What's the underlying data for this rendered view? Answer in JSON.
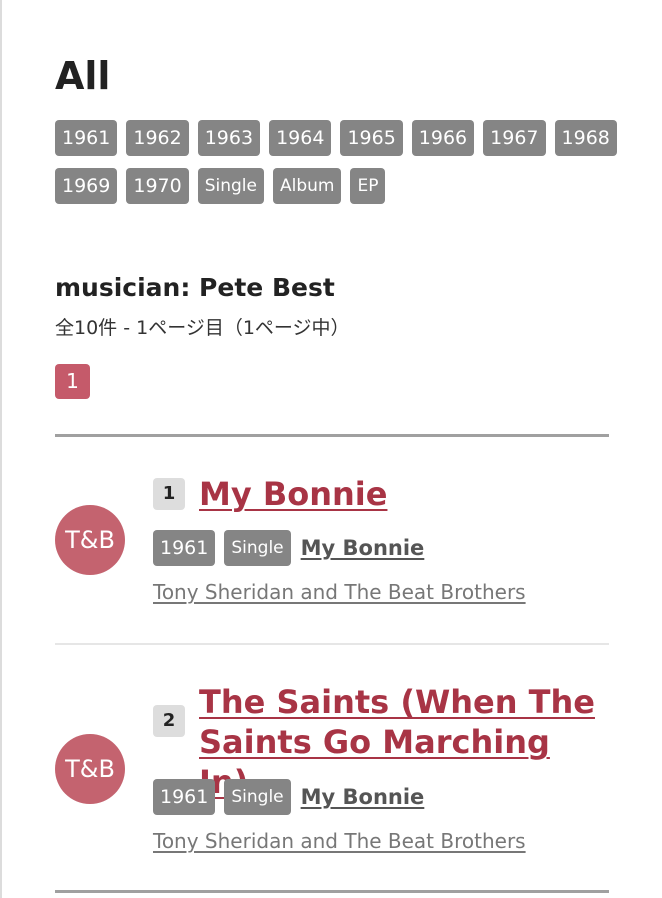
{
  "page": {
    "title": "All"
  },
  "filters": {
    "row1": [
      "1961",
      "1962",
      "1963",
      "1964",
      "1965",
      "1966",
      "1967",
      "1968"
    ],
    "row2": [
      "1969",
      "1970",
      "Single",
      "Album",
      "EP"
    ]
  },
  "section": {
    "heading": "musician: Pete Best",
    "summary": "全10件 - 1ページ目（1ページ中）"
  },
  "pagination": {
    "current": "1"
  },
  "tracks": [
    {
      "number": "1",
      "title": "My Bonnie",
      "avatar": "T&B",
      "year": "1961",
      "type": "Single",
      "album": "My Bonnie",
      "artist": "Tony Sheridan and The Beat Brothers"
    },
    {
      "number": "2",
      "title": "The Saints (When The Saints Go Marching In)",
      "avatar": "T&B",
      "year": "1961",
      "type": "Single",
      "album": "My Bonnie",
      "artist": "Tony Sheridan and The Beat Brothers"
    }
  ],
  "colors": {
    "accent": "#c55a6a",
    "title_link": "#a83445",
    "tag": "#858585"
  }
}
